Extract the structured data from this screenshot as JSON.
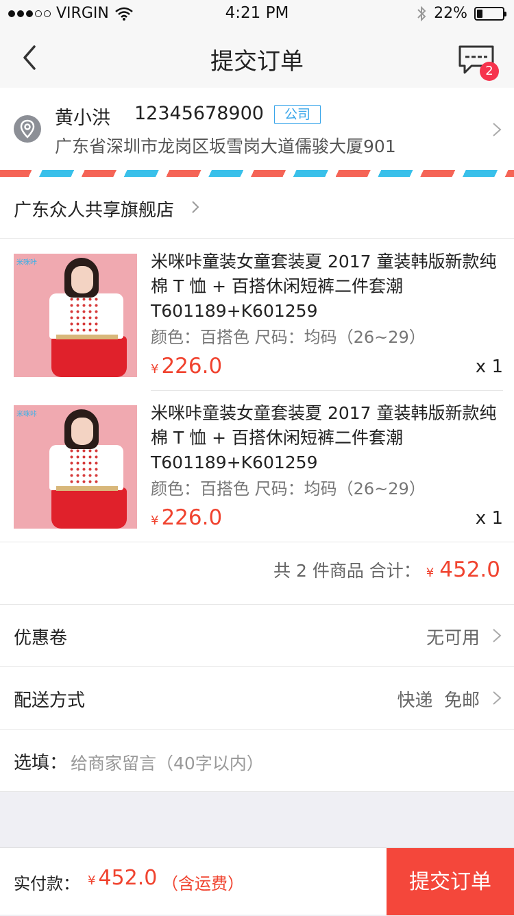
{
  "status_bar": {
    "carrier": "VIRGIN",
    "time": "4:21 PM",
    "battery": "22%",
    "battery_level": 0.22,
    "icons": [
      "signal-dots-icon",
      "wifi-icon",
      "bluetooth-icon",
      "battery-icon"
    ]
  },
  "nav": {
    "title": "提交订单",
    "message_badge": "2",
    "icons": [
      "back-chevron-icon",
      "message-icon"
    ]
  },
  "address": {
    "name": "黄小洪",
    "phone": "12345678900",
    "tag": "公司",
    "detail": "广东省深圳市龙岗区坂雪岗大道儒骏大厦901",
    "icon": "location-pin-icon"
  },
  "shop": {
    "name": "广东众人共享旗舰店"
  },
  "items": [
    {
      "title": "米咪咔童装女童套装夏 2017 童装韩版新款纯棉 T 恤 + 百搭休闲短裤二件套潮 T601189+K601259",
      "spec": "颜色：百搭色  尺码：均码（26~29）",
      "yen": "¥",
      "price": "226.0",
      "qty": "x 1"
    },
    {
      "title": "米咪咔童装女童套装夏 2017 童装韩版新款纯棉 T 恤 + 百搭休闲短裤二件套潮 T601189+K601259",
      "spec": "颜色：百搭色  尺码：均码（26~29）",
      "yen": "¥",
      "price": "226.0",
      "qty": "x 1"
    }
  ],
  "summary": {
    "text": "共 2 件商品 合计：",
    "yen": "¥",
    "amount": "452.0"
  },
  "coupon": {
    "label": "优惠卷",
    "value": "无可用"
  },
  "delivery": {
    "label": "配送方式",
    "value": "快递  免邮"
  },
  "note": {
    "label": "选填：",
    "placeholder": "给商家留言（40字以内）"
  },
  "footer": {
    "label": "实付款：",
    "yen": "¥",
    "amount": "452.0",
    "shipping_note": "（含运费）",
    "submit_label": "提交订单"
  },
  "colors": {
    "accent_red": "#f0432f",
    "submit_bg": "#f4473b",
    "badge_red": "#f6334d",
    "tag_blue": "#39a6ea",
    "stripe_red": "#f56456",
    "stripe_blue": "#39c0ea"
  }
}
